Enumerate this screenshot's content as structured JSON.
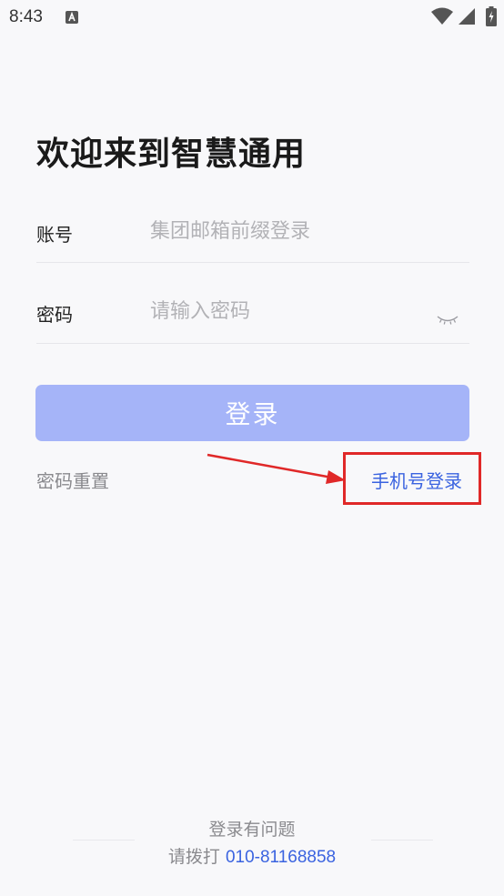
{
  "status_bar": {
    "time": "8:43",
    "notification_icon": "a-letter-icon",
    "wifi_icon": "wifi-icon",
    "signal_icon": "signal-icon",
    "battery_icon": "battery-charging-icon"
  },
  "title": "欢迎来到智慧通用",
  "account": {
    "label": "账号",
    "value": "",
    "placeholder": "集团邮箱前缀登录"
  },
  "password": {
    "label": "密码",
    "value": "",
    "placeholder": "请输入密码",
    "toggle_icon": "eye-closed-icon"
  },
  "login_button": {
    "label": "登录"
  },
  "links": {
    "reset_password": "密码重置",
    "phone_login": "手机号登录"
  },
  "footer": {
    "title": "登录有问题",
    "contact_prefix": "请拨打 ",
    "phone_number": "010-81168858"
  },
  "colors": {
    "accent": "#3a63e0",
    "button_disabled": "#a5b4f8",
    "annotation": "#e02828",
    "background": "#f8f8fa"
  }
}
